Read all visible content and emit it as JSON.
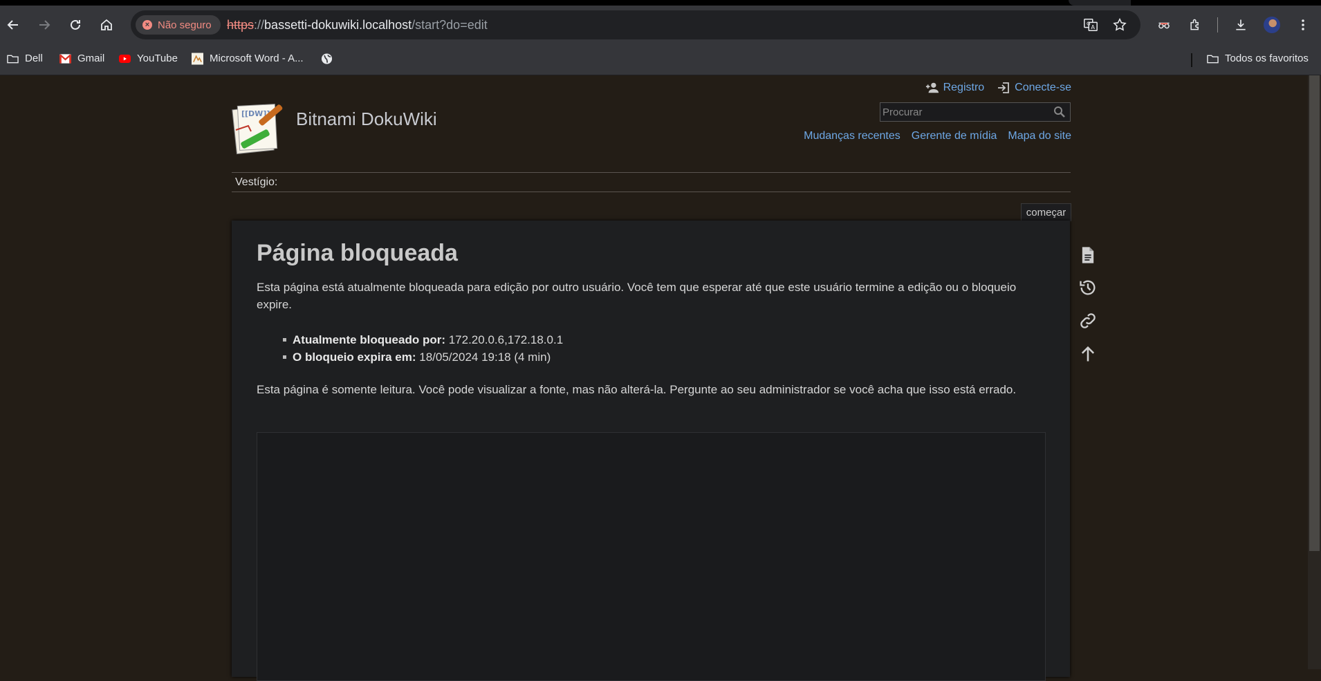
{
  "browser": {
    "security_chip": "Não seguro",
    "url": {
      "scheme": "https",
      "separator": "://",
      "host": "bassetti-dokuwiki.localhost",
      "path": "/start?do=edit"
    },
    "bookmarks": [
      {
        "label": "Dell",
        "icon": "folder-icon"
      },
      {
        "label": "Gmail",
        "icon": "gmail-icon"
      },
      {
        "label": "YouTube",
        "icon": "youtube-icon"
      },
      {
        "label": "Microsoft Word - A...",
        "icon": "word-doc-icon"
      },
      {
        "label": "",
        "icon": "globe-icon"
      }
    ],
    "all_bookmarks": "Todos os favoritos"
  },
  "site": {
    "title": "Bitnami DokuWiki",
    "user_links": {
      "register": "Registro",
      "login": "Conecte-se"
    },
    "search_placeholder": "Procurar",
    "site_tools": {
      "recent": "Mudanças recentes",
      "media": "Gerente de mídia",
      "sitemap": "Mapa do site"
    },
    "breadcrumb": "Vestígio:",
    "page_id": "começar"
  },
  "content": {
    "heading": "Página bloqueada",
    "intro": "Esta página está atualmente bloqueada para edição por outro usuário. Você tem que esperar até que este usuário termine a edição ou o bloqueio expire.",
    "locked_by_label": "Atualmente bloqueado por:",
    "locked_by_value": " 172.20.0.6,172.18.0.1",
    "expires_label": "O bloqueio expira em:",
    "expires_value": " 18/05/2024 19:18 (4 min)",
    "readonly_note": "Esta página é somente leitura. Você pode visualizar a fonte, mas não alterá-la. Pergunte ao seu administrador se você acha que isso está errado."
  },
  "colors": {
    "page_bg": "#231d16",
    "content_bg": "#1e1f21",
    "link": "#6ea8e6",
    "insecure": "#f28b82"
  }
}
